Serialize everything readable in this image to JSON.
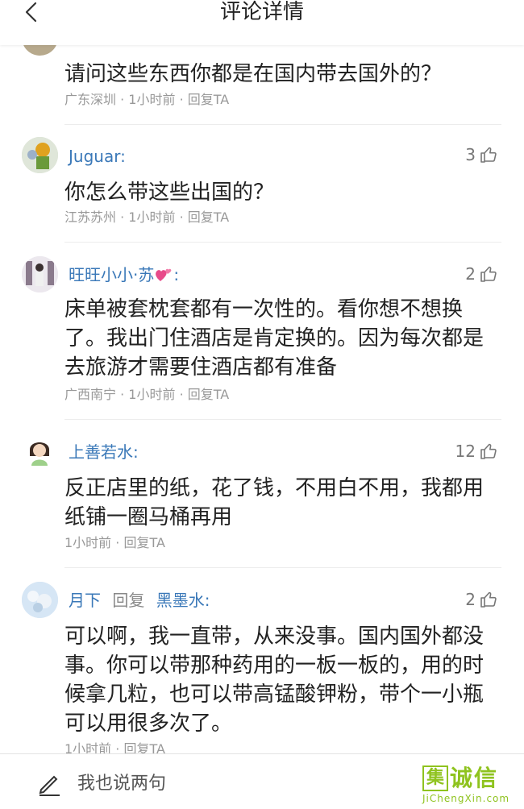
{
  "header": {
    "title": "评论详情"
  },
  "comments": [
    {
      "name": "",
      "reply_word": "",
      "reply_to": "",
      "likes": "",
      "text": "请问这些东西你都是在国内带去国外的？",
      "location": "广东深圳",
      "time": "1小时前",
      "reply": "回复TA"
    },
    {
      "name": "Juguar:",
      "reply_word": "",
      "reply_to": "",
      "likes": "3",
      "text": "你怎么带这些出国的？",
      "location": "江苏苏州",
      "time": "1小时前",
      "reply": "回复TA"
    },
    {
      "name": "旺旺小小·苏",
      "name_suffix": ":",
      "reply_word": "",
      "reply_to": "",
      "likes": "2",
      "text": "床单被套枕套都有一次性的。看你想不想换了。我出门住酒店是肯定换的。因为每次都是去旅游才需要住酒店都有准备",
      "location": "广西南宁",
      "time": "1小时前",
      "reply": "回复TA"
    },
    {
      "name": "上善若水:",
      "reply_word": "",
      "reply_to": "",
      "likes": "12",
      "text": "反正店里的纸，花了钱，不用白不用，我都用纸铺一圈马桶再用",
      "location": "",
      "time": "1小时前",
      "reply": "回复TA"
    },
    {
      "name": "月下",
      "reply_word": "回复",
      "reply_to": "黑墨水:",
      "likes": "2",
      "text": "可以啊，我一直带，从来没事。国内国外都没事。你可以带那种药用的一板一板的，用的时候拿几粒，也可以带高锰酸钾粉，带个一小瓶可以用很多次了。",
      "location": "",
      "time": "1小时前",
      "reply": "回复TA"
    }
  ],
  "footer": {
    "placeholder": "我也说两句"
  },
  "watermark": {
    "box_char": "集",
    "chars": "诚信",
    "url": "JiChengXin.com"
  },
  "icons": {
    "back": "chevron-left-icon",
    "like": "thumbs-up-icon",
    "compose": "pen-icon",
    "heart": "heart-icon"
  },
  "colors": {
    "name": "#3a78b8",
    "meta": "#999999",
    "watermark": "#8fc31f"
  }
}
